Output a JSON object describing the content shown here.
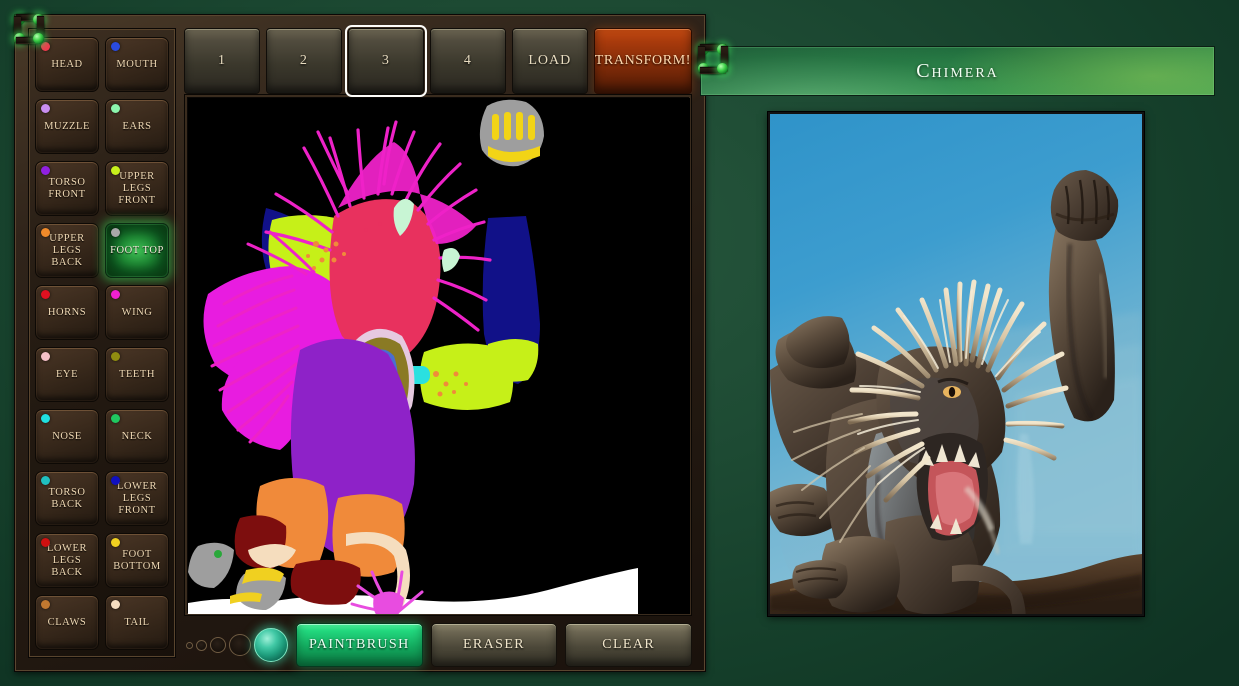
{
  "app": {
    "background_color": "#1d4a33",
    "accent_green": "#22d87e"
  },
  "parts_panel": {
    "name": "body-part-palette",
    "items": [
      {
        "label": "HEAD",
        "color": "#f03a4e",
        "selected": false
      },
      {
        "label": "MOUTH",
        "color": "#2a4be0",
        "selected": false
      },
      {
        "label": "MUZZLE",
        "color": "#c98ef0",
        "selected": false
      },
      {
        "label": "EARS",
        "color": "#8cf5ad",
        "selected": false
      },
      {
        "label": "TORSO FRONT",
        "color": "#9020e0",
        "selected": false
      },
      {
        "label": "UPPER LEGS FRONT",
        "color": "#c8f01c",
        "selected": false
      },
      {
        "label": "UPPER LEGS BACK",
        "color": "#f08a2a",
        "selected": false
      },
      {
        "label": "FOOT TOP",
        "color": "#a8a8a8",
        "selected": true
      },
      {
        "label": "HORNS",
        "color": "#e01020",
        "selected": false
      },
      {
        "label": "WING",
        "color": "#f020d0",
        "selected": false
      },
      {
        "label": "EYE",
        "color": "#f5c0c8",
        "selected": false
      },
      {
        "label": "TEETH",
        "color": "#908c10",
        "selected": false
      },
      {
        "label": "NOSE",
        "color": "#20e0e0",
        "selected": false
      },
      {
        "label": "NECK",
        "color": "#20c860",
        "selected": false
      },
      {
        "label": "TORSO BACK",
        "color": "#20c0c0",
        "selected": false
      },
      {
        "label": "LOWER LEGS FRONT",
        "color": "#1010c0",
        "selected": false
      },
      {
        "label": "LOWER LEGS BACK",
        "color": "#d01010",
        "selected": false
      },
      {
        "label": "FOOT BOTTOM",
        "color": "#f0d020",
        "selected": false
      },
      {
        "label": "CLAWS",
        "color": "#c07830",
        "selected": false
      },
      {
        "label": "TAIL",
        "color": "#f5ddc0",
        "selected": false
      }
    ]
  },
  "top_bar": {
    "name": "slot-tabs",
    "tabs": [
      {
        "label": "1",
        "active": false,
        "style": "normal"
      },
      {
        "label": "2",
        "active": false,
        "style": "normal"
      },
      {
        "label": "3",
        "active": true,
        "style": "normal"
      },
      {
        "label": "4",
        "active": false,
        "style": "normal"
      },
      {
        "label": "LOAD",
        "active": false,
        "style": "normal"
      },
      {
        "label": "TRANSFORM!",
        "active": false,
        "style": "transform"
      }
    ]
  },
  "tool_bar": {
    "brush_sizes": [
      {
        "size": 7,
        "active": false
      },
      {
        "size": 11,
        "active": false
      },
      {
        "size": 16,
        "active": false
      },
      {
        "size": 22,
        "active": false
      },
      {
        "size": 34,
        "active": true
      }
    ],
    "buttons": [
      {
        "label": "PAINTBRUSH",
        "active": true
      },
      {
        "label": "ERASER",
        "active": false
      },
      {
        "label": "CLEAR",
        "active": false
      }
    ]
  },
  "preview": {
    "title": "Chimera",
    "image_description": "GAN-generated shaggy chimera creature roaring, raised fist, against blue sky with rocky ledge"
  },
  "canvas": {
    "name": "segmentation-canvas",
    "background": "#000000",
    "description": "Segmentation map of a roaring chimera painted with body-part color labels"
  }
}
